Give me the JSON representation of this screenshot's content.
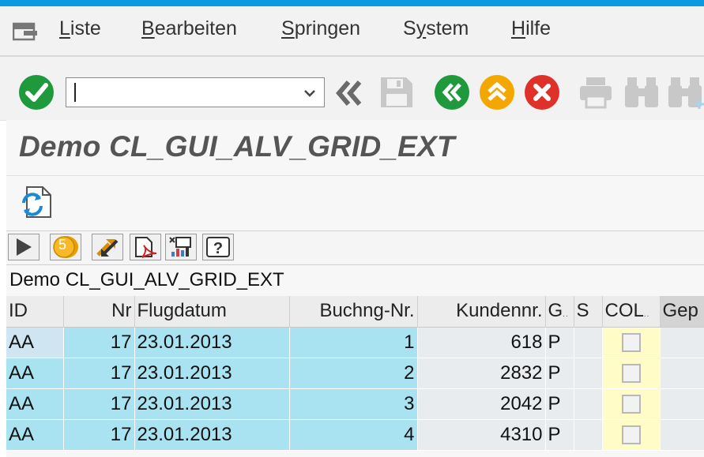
{
  "menu": {
    "items": [
      {
        "label": "Liste",
        "underline": "L",
        "rest": "iste"
      },
      {
        "label": "Bearbeiten",
        "underline": "B",
        "rest": "earbeiten"
      },
      {
        "label": "Springen",
        "underline": "S",
        "rest": "pringen"
      },
      {
        "label": "System",
        "underline": "y",
        "prefix": "S",
        "rest": "stem"
      },
      {
        "label": "Hilfe",
        "underline": "H",
        "rest": "ilfe"
      }
    ]
  },
  "toolbar": {
    "command_field_value": "",
    "icons": [
      "enter-icon",
      "command-dropdown-icon",
      "collapse-toolbar-icon",
      "save-icon",
      "back-icon",
      "exit-icon",
      "cancel-icon",
      "print-icon",
      "find-icon",
      "find-next-icon"
    ]
  },
  "title": {
    "text": "Demo CL_GUI_ALV_GRID_EXT"
  },
  "grid": {
    "title": "Demo CL_GUI_ALV_GRID_EXT",
    "toolbar_badge": "5",
    "columns": [
      "ID",
      "Nr",
      "Flugdatum",
      "Buchng-Nr.",
      "Kundennr.",
      "G",
      "S",
      "COL",
      "Gep"
    ],
    "rows": [
      {
        "id": "AA",
        "nr": "17",
        "flugdatum": "23.01.2013",
        "buchng_nr": "1",
        "kundennr": "618",
        "g": "P",
        "s": "",
        "col": false
      },
      {
        "id": "AA",
        "nr": "17",
        "flugdatum": "23.01.2013",
        "buchng_nr": "2",
        "kundennr": "2832",
        "g": "P",
        "s": "",
        "col": false
      },
      {
        "id": "AA",
        "nr": "17",
        "flugdatum": "23.01.2013",
        "buchng_nr": "3",
        "kundennr": "2042",
        "g": "P",
        "s": "",
        "col": false
      },
      {
        "id": "AA",
        "nr": "17",
        "flugdatum": "23.01.2013",
        "buchng_nr": "4",
        "kundennr": "4310",
        "g": "P",
        "s": "",
        "col": false
      }
    ]
  },
  "colors": {
    "accent_strip": "#0a9ae0",
    "green": "#1e9a3c",
    "orange": "#f4a700",
    "red": "#e0302a",
    "key_cell": "#a9e2f1",
    "col_cell": "#fffcc8"
  }
}
